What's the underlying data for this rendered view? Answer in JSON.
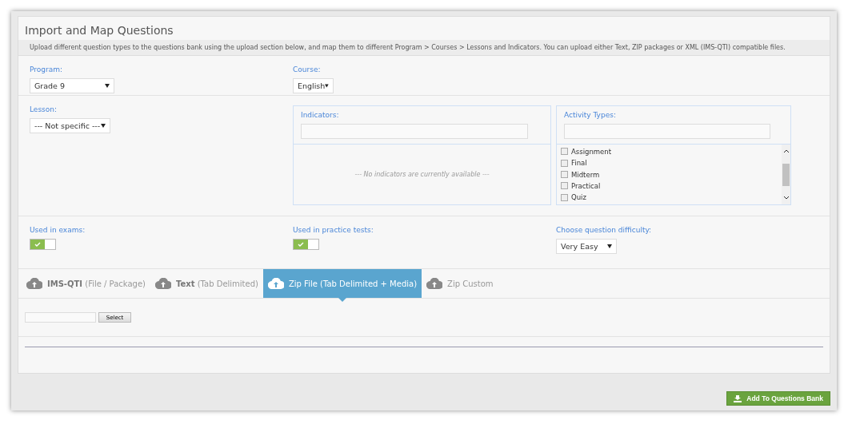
{
  "title": "Import and Map Questions",
  "description": "Upload different question types to the questions bank using the upload section below, and map them to different Program > Courses > Lessons and Indicators. You can upload either Text, ZIP packages or XML (IMS-QTI) compatible files.",
  "program": {
    "label": "Program:",
    "value": "Grade 9"
  },
  "course": {
    "label": "Course:",
    "value": "English"
  },
  "lesson": {
    "label": "Lesson:",
    "value": "--- Not specific ---"
  },
  "indicators": {
    "label": "Indicators:",
    "empty_message": "--- No indicators are currently available ---"
  },
  "activity_types": {
    "label": "Activity Types:",
    "items": [
      {
        "label": "Assignment",
        "checked": false
      },
      {
        "label": "Final",
        "checked": false
      },
      {
        "label": "Midterm",
        "checked": false
      },
      {
        "label": "Practical",
        "checked": false
      },
      {
        "label": "Quiz",
        "checked": false
      }
    ]
  },
  "used_in_exams": {
    "label": "Used in exams:",
    "on": true
  },
  "used_in_practice_tests": {
    "label": "Used in practice tests:",
    "on": true
  },
  "difficulty": {
    "label": "Choose question difficulty:",
    "value": "Very Easy"
  },
  "upload_tabs": [
    {
      "label": "**IMS-QTI** (File / Package)",
      "selected": false
    },
    {
      "label": "**Text** (Tab Delimited)",
      "selected": false
    },
    {
      "label": "Zip File (Tab Delimited + Media)",
      "selected": true
    },
    {
      "label": "Zip Custom",
      "selected": false
    }
  ],
  "file_select": {
    "button": "Select"
  },
  "submit_button": "Add To Questions Bank"
}
